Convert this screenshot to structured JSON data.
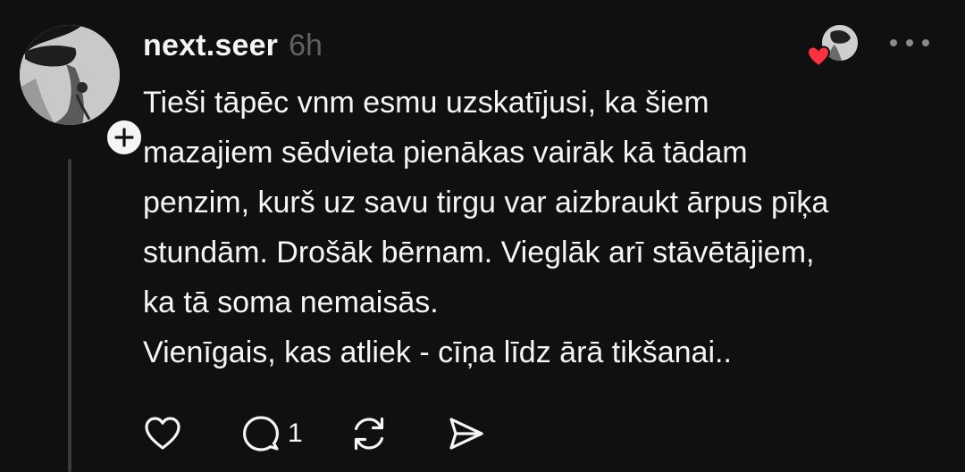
{
  "post": {
    "author": {
      "username": "next.seer",
      "avatar_icon": "profile-photo",
      "follow_icon": "plus-icon"
    },
    "time_ago": "6h",
    "liked_by_icon": "heart-icon",
    "more_icon": "more-dots-icon",
    "text_lines": [
      "Tieši tāpēc vnm esmu uzskatījusi, ka šiem",
      "mazajiem sēdvieta pienākas vairāk kā tādam",
      "penzim, kurš uz savu tirgu var aizbraukt ārpus pīķa",
      "stundām. Drošāk bērnam. Vieglāk arī stāvētājiem,",
      "ka tā soma nemaisās.",
      "Vienīgais, kas atliek - cīņa līdz ārā tikšanai.."
    ],
    "actions": {
      "like_icon": "heart-outline-icon",
      "reply_icon": "comment-icon",
      "reply_count": "1",
      "repost_icon": "repost-icon",
      "share_icon": "send-icon"
    }
  },
  "colors": {
    "background": "#101010",
    "text": "#f3f5f7",
    "muted": "#616161",
    "thread_line": "#3a3a3a",
    "heart": "#ff3040"
  }
}
